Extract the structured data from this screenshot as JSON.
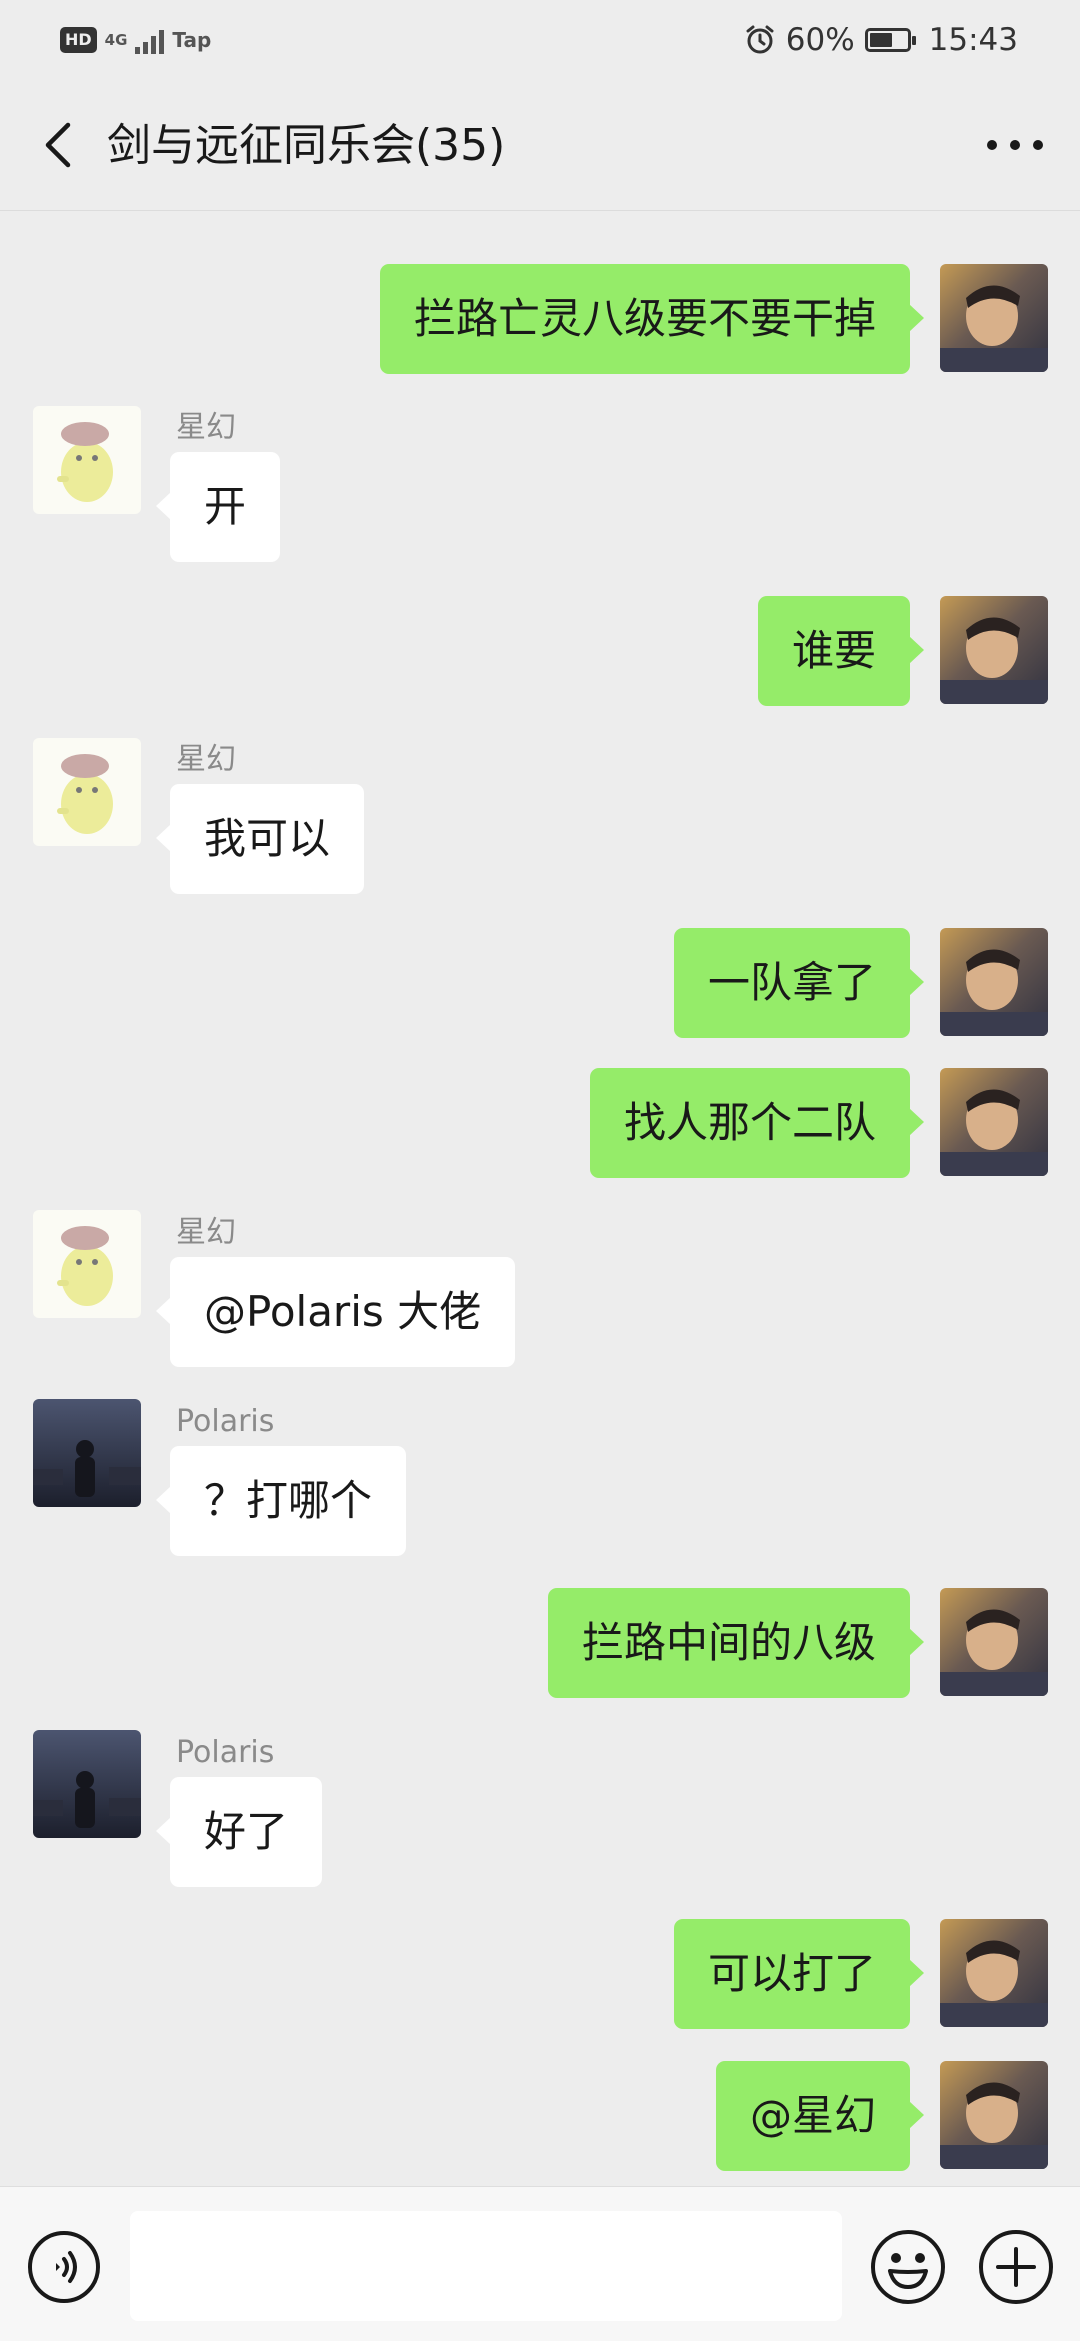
{
  "status_bar": {
    "hd": "HD",
    "network": "4G",
    "carrier": "Tap",
    "battery": "60%",
    "battery_level": 0.6,
    "time": "15:43"
  },
  "header": {
    "title": "剑与远征同乐会(35)"
  },
  "messages": [
    {
      "sender": "self",
      "text": "拦路亡灵八级要不要干掉"
    },
    {
      "sender": "星幻",
      "text": "开"
    },
    {
      "sender": "self",
      "text": "谁要"
    },
    {
      "sender": "星幻",
      "text": "我可以"
    },
    {
      "sender": "self",
      "text": "一队拿了"
    },
    {
      "sender": "self",
      "text": "找人那个二队"
    },
    {
      "sender": "星幻",
      "text": "@Polaris  大佬"
    },
    {
      "sender": "Polaris",
      "text": "？打哪个"
    },
    {
      "sender": "self",
      "text": "拦路中间的八级"
    },
    {
      "sender": "Polaris",
      "text": "好了"
    },
    {
      "sender": "self",
      "text": "可以打了"
    },
    {
      "sender": "self",
      "text": "@星幻"
    }
  ],
  "input": {
    "value": "",
    "placeholder": ""
  },
  "colors": {
    "background": "#ededed",
    "bubble_mine": "#95ec69",
    "bubble_theirs": "#ffffff"
  },
  "icons": [
    "back-arrow-icon",
    "more-dots-icon",
    "voice-icon",
    "emoji-icon",
    "plus-icon"
  ]
}
